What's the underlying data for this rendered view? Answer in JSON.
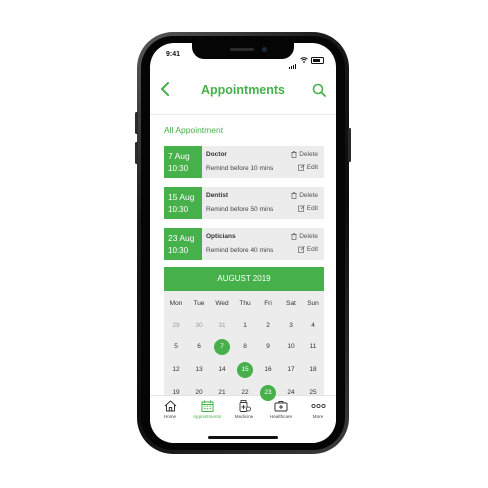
{
  "status": {
    "time": "9:41"
  },
  "header": {
    "title": "Appointments",
    "back_icon": "chevron-left-icon",
    "search_icon": "search-icon"
  },
  "section_title": "All Appointment",
  "appointments": [
    {
      "date": "7 Aug",
      "time": "10:30",
      "type": "Doctor",
      "remind": "Remind before 10 mins",
      "delete_label": "Delete",
      "edit_label": "Edit"
    },
    {
      "date": "15 Aug",
      "time": "10:30",
      "type": "Dentist",
      "remind": "Remind before 50 mins",
      "delete_label": "Delete",
      "edit_label": "Edit"
    },
    {
      "date": "23 Aug",
      "time": "10:30",
      "type": "Opticians",
      "remind": "Remind before 40 mins",
      "delete_label": "Delete",
      "edit_label": "Edit"
    }
  ],
  "calendar": {
    "month": "AUGUST 2019",
    "weekdays": [
      "Mon",
      "Tue",
      "Wed",
      "Thu",
      "Fri",
      "Sat",
      "Sun"
    ],
    "weeks": [
      [
        "29",
        "30",
        "31",
        "1",
        "2",
        "3",
        "4"
      ],
      [
        "5",
        "6",
        "7",
        "8",
        "9",
        "10",
        "11"
      ],
      [
        "12",
        "13",
        "14",
        "15",
        "16",
        "17",
        "18"
      ],
      [
        "19",
        "20",
        "21",
        "22",
        "23",
        "24",
        "25"
      ]
    ],
    "muted_days": [
      "29",
      "30",
      "31"
    ],
    "selected_days": [
      "7",
      "15",
      "23"
    ]
  },
  "tabs": [
    {
      "label": "Home",
      "icon": "home-icon",
      "active": false
    },
    {
      "label": "Appointments",
      "icon": "calendar-icon",
      "active": true
    },
    {
      "label": "Medicine",
      "icon": "medicine-bottle-icon",
      "active": false
    },
    {
      "label": "Healthcare",
      "icon": "medical-kit-icon",
      "active": false
    },
    {
      "label": "More",
      "icon": "more-dots-icon",
      "active": false
    }
  ],
  "colors": {
    "accent": "#46b04a",
    "card_bg": "#ececec",
    "text": "#333333"
  }
}
